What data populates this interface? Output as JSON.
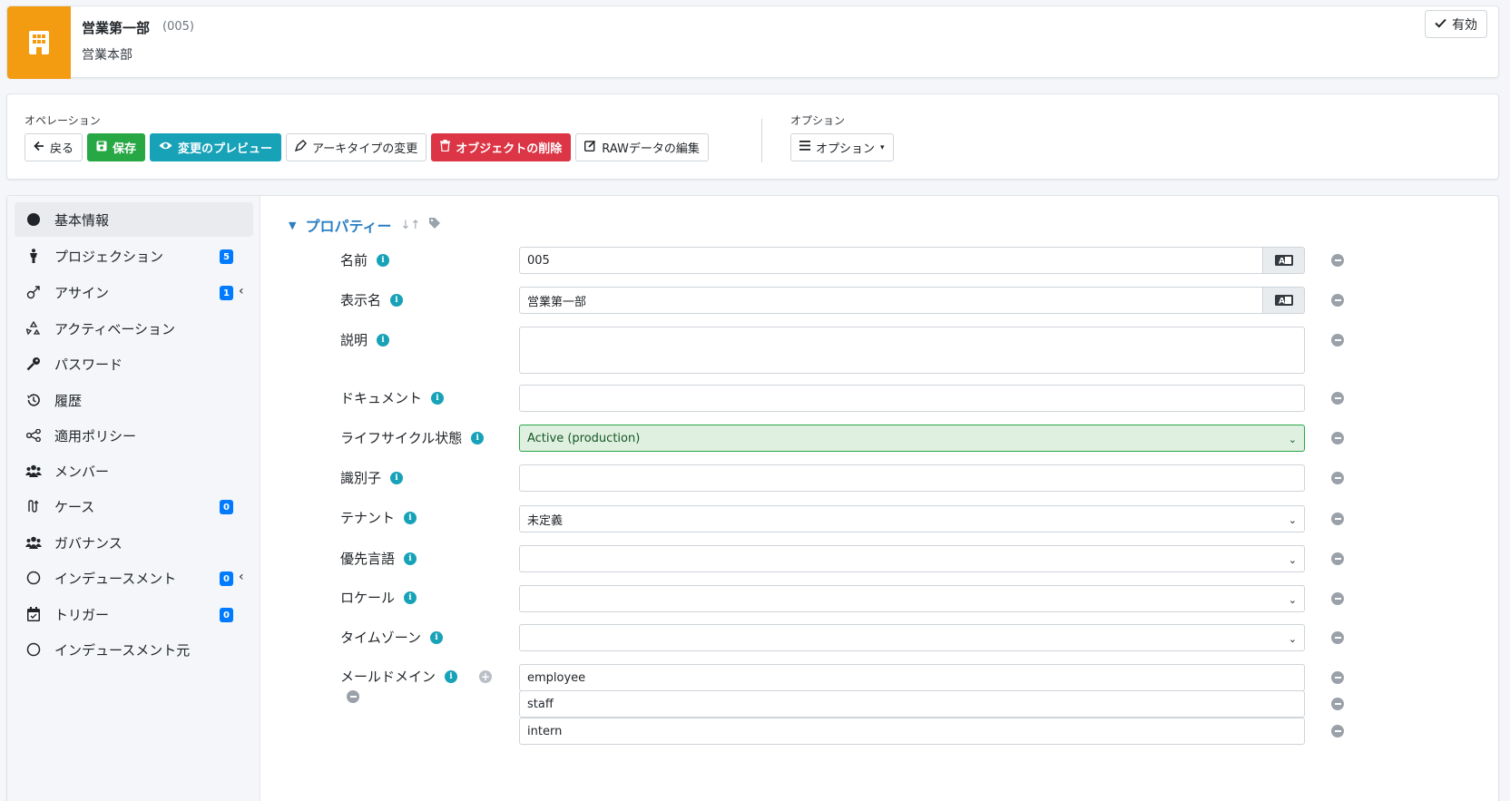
{
  "header": {
    "title": "営業第一部",
    "oid": "(005)",
    "parent": "営業本部",
    "status_label": "有効",
    "accent_color": "#f39c12"
  },
  "operations": {
    "label": "オペレーション",
    "buttons": {
      "back": "戻る",
      "save": "保存",
      "preview": "変更のプレビュー",
      "archetype": "アーキタイプの変更",
      "delete": "オブジェクトの削除",
      "raw": "RAWデータの編集"
    },
    "options_label": "オプション",
    "options_button": "オプション"
  },
  "sidebar": {
    "items": [
      {
        "label": "基本情報",
        "icon": "circle-filled-icon"
      },
      {
        "label": "プロジェクション",
        "icon": "person-icon",
        "badge": "5"
      },
      {
        "label": "アサイン",
        "icon": "assign-icon",
        "badge": "1"
      },
      {
        "label": "アクティベーション",
        "icon": "recycle-icon"
      },
      {
        "label": "パスワード",
        "icon": "key-icon"
      },
      {
        "label": "履歴",
        "icon": "history-icon"
      },
      {
        "label": "適用ポリシー",
        "icon": "share-icon"
      },
      {
        "label": "メンバー",
        "icon": "users-icon"
      },
      {
        "label": "ケース",
        "icon": "case-icon",
        "badge": "0"
      },
      {
        "label": "ガバナンス",
        "icon": "users-icon"
      },
      {
        "label": "インデュースメント",
        "icon": "circle-outline-icon",
        "badge": "0"
      },
      {
        "label": "トリガー",
        "icon": "calendar-icon",
        "badge": "0"
      },
      {
        "label": "インデュースメント元",
        "icon": "circle-outline-icon"
      }
    ]
  },
  "properties": {
    "title": "プロパティー",
    "rows": [
      {
        "label": "名前",
        "value": "005"
      },
      {
        "label": "表示名",
        "value": "営業第一部"
      },
      {
        "label": "説明",
        "value": ""
      },
      {
        "label": "ドキュメント",
        "value": ""
      },
      {
        "label": "ライフサイクル状態",
        "value": "Active (production)"
      },
      {
        "label": "識別子",
        "value": ""
      },
      {
        "label": "テナント",
        "value": "未定義"
      },
      {
        "label": "優先言語",
        "value": ""
      },
      {
        "label": "ロケール",
        "value": ""
      },
      {
        "label": "タイムゾーン",
        "value": ""
      },
      {
        "label": "メールドメイン",
        "values": [
          "employee",
          "staff",
          "intern"
        ]
      }
    ]
  }
}
